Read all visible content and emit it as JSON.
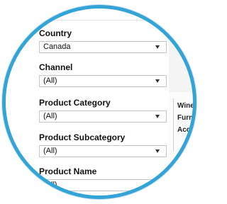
{
  "filters": [
    {
      "label": "Country",
      "value": "Canada"
    },
    {
      "label": "Channel",
      "value": "(All)"
    },
    {
      "label": "Product Category",
      "value": "(All)"
    },
    {
      "label": "Product Subcategory",
      "value": "(All)"
    },
    {
      "label": "Product Name",
      "value": "(All)"
    }
  ],
  "side": {
    "cat1": "Wine",
    "cat2": "Furnitu",
    "cat3": "Acces"
  },
  "colors": {
    "ring": "#34a4d6"
  }
}
